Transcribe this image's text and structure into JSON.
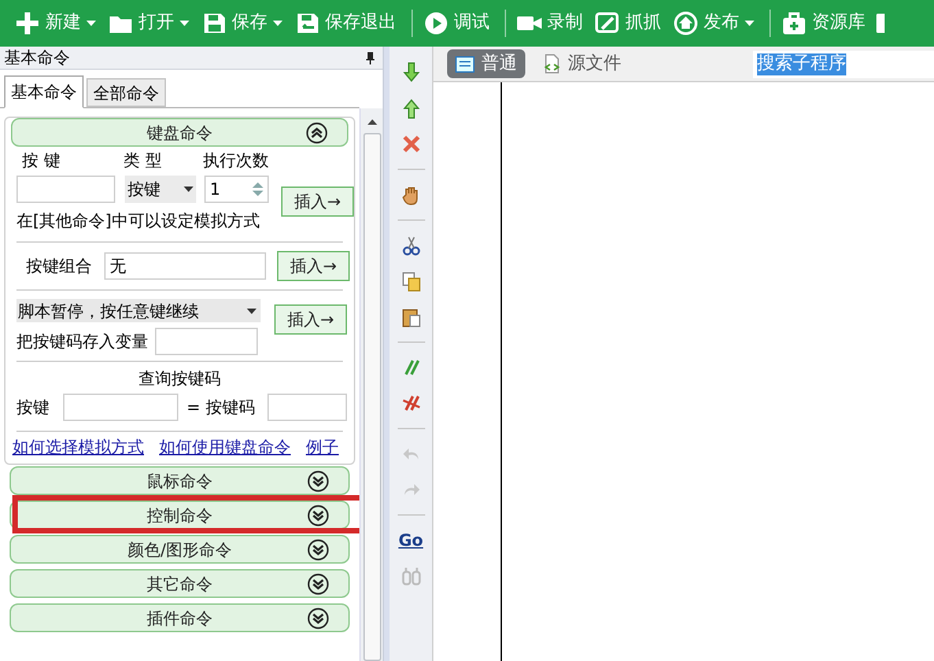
{
  "toolbar": {
    "items": [
      {
        "label": "新建",
        "dropdown": true,
        "separator_before": false
      },
      {
        "label": "打开",
        "dropdown": true,
        "separator_before": false
      },
      {
        "label": "保存",
        "dropdown": true,
        "separator_before": false
      },
      {
        "label": "保存退出",
        "dropdown": false,
        "separator_before": false
      },
      {
        "label": "调试",
        "dropdown": false,
        "separator_before": true
      },
      {
        "label": "录制",
        "dropdown": false,
        "separator_before": true
      },
      {
        "label": "抓抓",
        "dropdown": false,
        "separator_before": false
      },
      {
        "label": "发布",
        "dropdown": true,
        "separator_before": false
      },
      {
        "label": "资源库",
        "dropdown": false,
        "separator_before": true
      }
    ]
  },
  "command_panel": {
    "title": "基本命令",
    "tabs": [
      {
        "label": "基本命令",
        "selected": true
      },
      {
        "label": "全部命令",
        "selected": false
      }
    ],
    "keyboard_section": {
      "title": "键盘命令",
      "expanded": true,
      "col_labels": [
        "按 键",
        "类 型",
        "执行次数"
      ],
      "key_type": "按键",
      "repeat_count": "1",
      "insert_labels": [
        "插入→",
        "插入→",
        "插入→"
      ],
      "hint": "在[其他命令]中可以设定模拟方式",
      "combo_label": "按键组合",
      "combo_value": "无",
      "pause_option": "脚本暂停，按任意键继续",
      "store_label": "把按键码存入变量",
      "query_title": "查询按键码",
      "query_key_label": "按键",
      "query_code_label": "= 按键码",
      "links": [
        "如何选择模拟方式",
        "如何使用键盘命令",
        "例子"
      ]
    },
    "sections": [
      {
        "title": "鼠标命令",
        "expanded": false,
        "highlighted": false
      },
      {
        "title": "控制命令",
        "expanded": false,
        "highlighted": true
      },
      {
        "title": "颜色/图形命令",
        "expanded": false,
        "highlighted": false
      },
      {
        "title": "其它命令",
        "expanded": false,
        "highlighted": false
      },
      {
        "title": "插件命令",
        "expanded": false,
        "highlighted": false
      }
    ]
  },
  "side_toolbar": {
    "go_label": "Go"
  },
  "editor": {
    "tabs": [
      {
        "label": "普通",
        "selected": true
      },
      {
        "label": "源文件",
        "selected": false
      }
    ],
    "search": {
      "value": "搜索子程序",
      "text_selected": true
    }
  }
}
